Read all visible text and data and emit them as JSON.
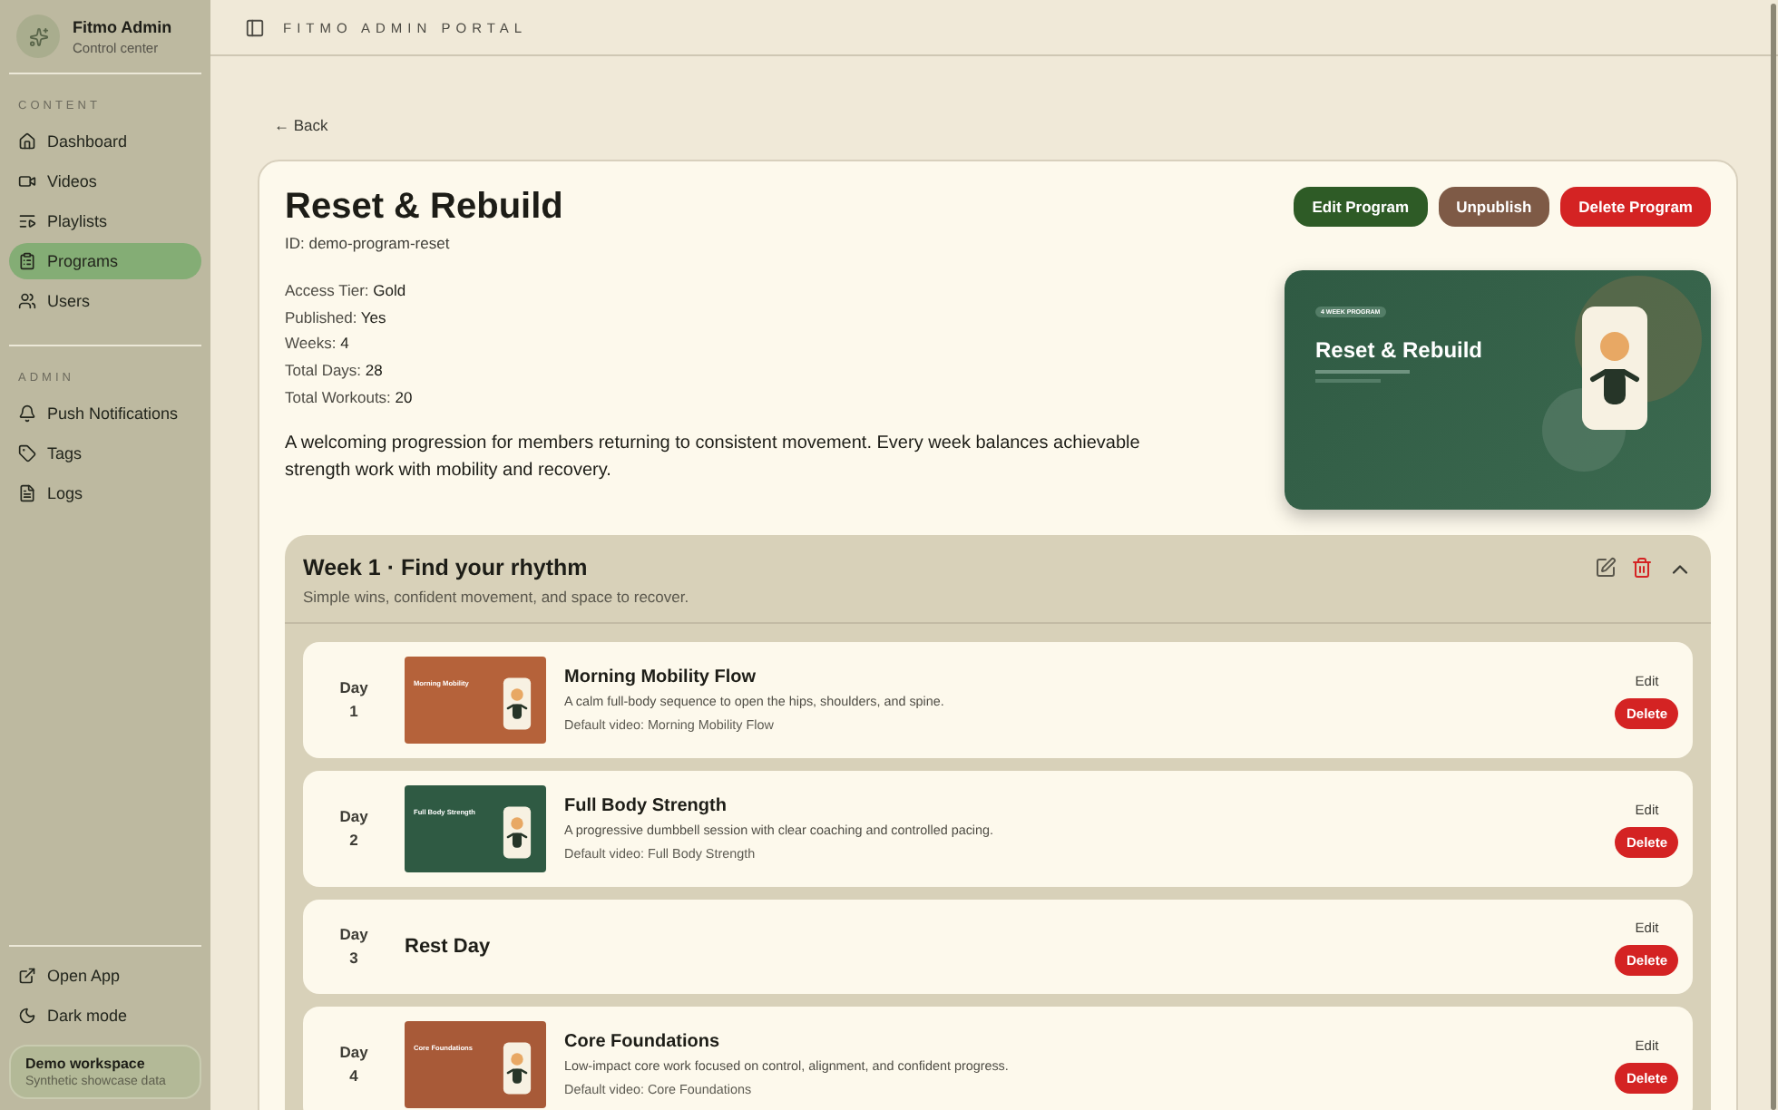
{
  "sidebar": {
    "brand": {
      "title": "Fitmo Admin",
      "subtitle": "Control center"
    },
    "sections": [
      {
        "heading": "CONTENT",
        "items": [
          {
            "label": "Dashboard",
            "selected": false
          },
          {
            "label": "Videos",
            "selected": false
          },
          {
            "label": "Playlists",
            "selected": false
          },
          {
            "label": "Programs",
            "selected": true
          },
          {
            "label": "Users",
            "selected": false
          }
        ]
      },
      {
        "heading": "ADMIN",
        "items": [
          {
            "label": "Push Notifications",
            "selected": false
          },
          {
            "label": "Tags",
            "selected": false
          },
          {
            "label": "Logs",
            "selected": false
          }
        ]
      }
    ],
    "footer_items": [
      {
        "label": "Open App"
      },
      {
        "label": "Dark mode"
      }
    ],
    "workspace": {
      "title": "Demo workspace",
      "subtitle": "Synthetic showcase data"
    }
  },
  "header": {
    "title": "FITMO ADMIN PORTAL"
  },
  "back": "← Back",
  "program": {
    "title": "Reset & Rebuild",
    "id": "ID: demo-program-reset",
    "actions": [
      {
        "label": "Edit Program",
        "kind": "primary"
      },
      {
        "label": "Unpublish",
        "kind": "secondary"
      },
      {
        "label": "Delete Program",
        "kind": "danger"
      }
    ],
    "facts": [
      {
        "label": "Access Tier:",
        "value": "Gold"
      },
      {
        "label": "Published:",
        "value": "Yes"
      },
      {
        "label": "Weeks:",
        "value": "4"
      },
      {
        "label": "Total Days:",
        "value": "28"
      },
      {
        "label": "Total Workouts:",
        "value": "20"
      }
    ],
    "description": "A welcoming progression for members returning to consistent movement. Every week balances achievable strength work with mobility and recovery.",
    "cover": {
      "badge": "4 WEEK PROGRAM",
      "title": "Reset & Rebuild"
    }
  },
  "week": {
    "title": "Week 1 · Find your rhythm",
    "subtitle": "Simple wins, confident movement, and space to recover.",
    "expanded": true,
    "days": [
      {
        "kind": "workout",
        "day": "Day",
        "number": "1",
        "thumb_title": "Morning Mobility",
        "color": "#b5623a",
        "title": "Morning Mobility Flow",
        "description": "A calm full-body sequence to open the hips, shoulders, and spine.",
        "video": "Default video: Morning Mobility Flow",
        "edit": "Edit",
        "delete": "Delete"
      },
      {
        "kind": "workout",
        "day": "Day",
        "number": "2",
        "thumb_title": "Full Body Strength",
        "color": "#2f5a43",
        "title": "Full Body Strength",
        "description": "A progressive dumbbell session with clear coaching and controlled pacing.",
        "video": "Default video: Full Body Strength",
        "edit": "Edit",
        "delete": "Delete"
      },
      {
        "kind": "rest",
        "day": "Day",
        "number": "3",
        "title": "Rest Day",
        "edit": "Edit",
        "delete": "Delete"
      },
      {
        "kind": "workout",
        "day": "Day",
        "number": "4",
        "thumb_title": "Core Foundations",
        "color": "#a85a38",
        "title": "Core Foundations",
        "description": "Low-impact core work focused on control, alignment, and confident progress.",
        "video": "Default video: Core Foundations",
        "edit": "Edit",
        "delete": "Delete"
      }
    ]
  }
}
